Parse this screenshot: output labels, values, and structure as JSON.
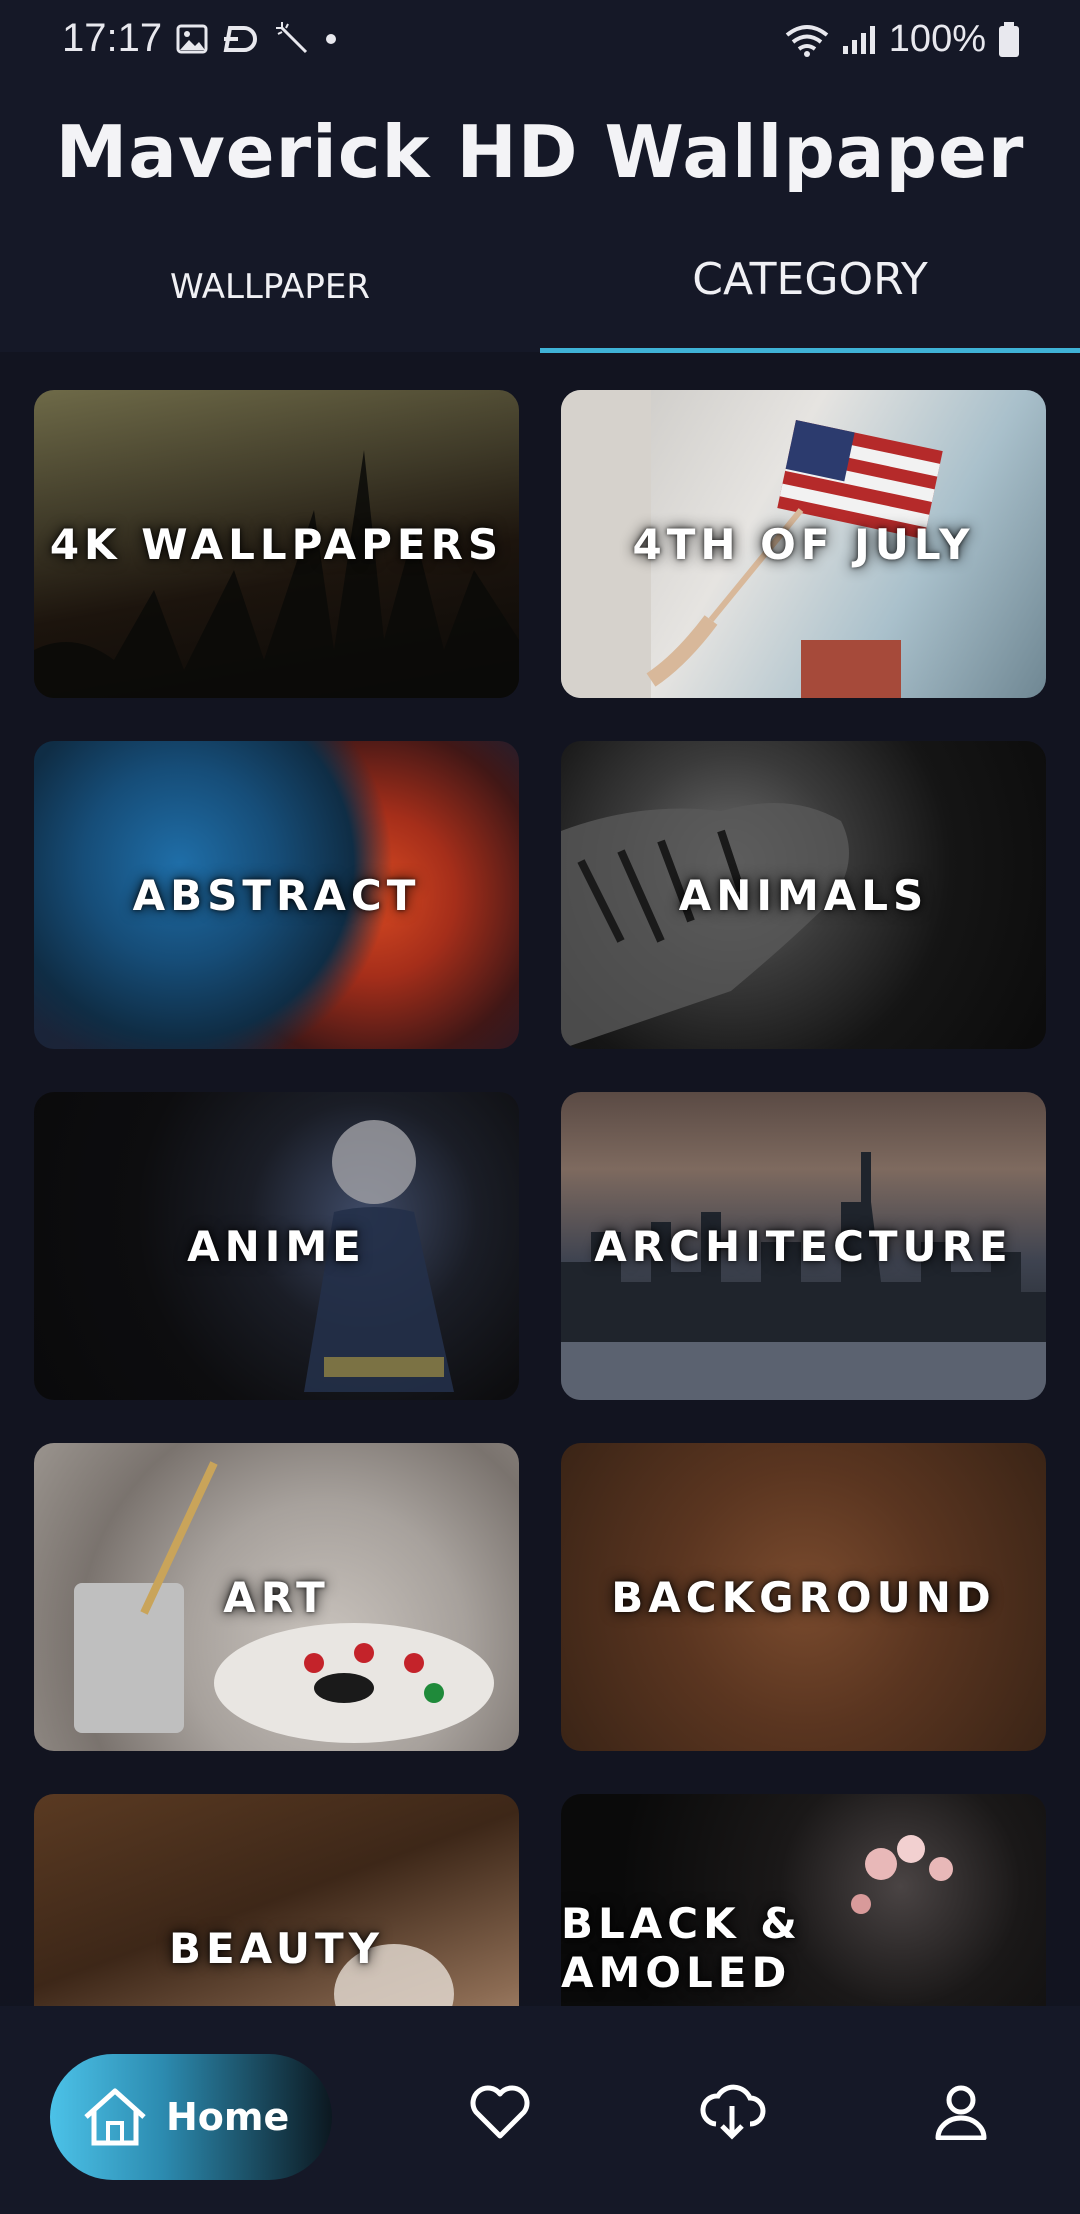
{
  "status": {
    "time": "17:17",
    "battery": "100%"
  },
  "app": {
    "title": "Maverick HD Wallpaper"
  },
  "tabs": {
    "wallpaper": "WALLPAPER",
    "category": "CATEGORY",
    "active": "CATEGORY"
  },
  "categories": [
    {
      "label": "4K WALLPAPERS"
    },
    {
      "label": "4TH OF JULY"
    },
    {
      "label": "ABSTRACT"
    },
    {
      "label": "ANIMALS"
    },
    {
      "label": "ANIME"
    },
    {
      "label": "ARCHITECTURE"
    },
    {
      "label": "ART"
    },
    {
      "label": "BACKGROUND"
    },
    {
      "label": "BEAUTY"
    },
    {
      "label": "BLACK & AMOLED"
    }
  ],
  "nav": {
    "home_label": "Home",
    "icons": [
      "home-icon",
      "heart-icon",
      "cloud-download-icon",
      "profile-icon"
    ]
  },
  "colors": {
    "background": "#121420",
    "accent": "#3fb2d6"
  }
}
